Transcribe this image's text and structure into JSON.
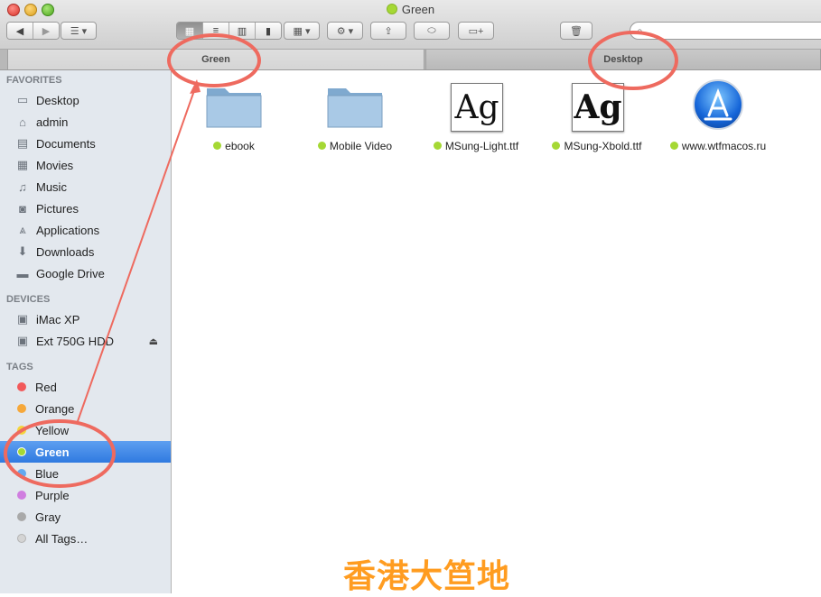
{
  "window": {
    "title": "Green"
  },
  "tabs": [
    {
      "label": "Green",
      "active": true
    },
    {
      "label": "Desktop",
      "active": false
    }
  ],
  "sidebar": {
    "favorites_header": "FAVORITES",
    "favorites": [
      {
        "label": "Desktop",
        "icon": "desktop-icon"
      },
      {
        "label": "admin",
        "icon": "home-icon"
      },
      {
        "label": "Documents",
        "icon": "documents-icon"
      },
      {
        "label": "Movies",
        "icon": "movies-icon"
      },
      {
        "label": "Music",
        "icon": "music-icon"
      },
      {
        "label": "Pictures",
        "icon": "pictures-icon"
      },
      {
        "label": "Applications",
        "icon": "applications-icon"
      },
      {
        "label": "Downloads",
        "icon": "downloads-icon"
      },
      {
        "label": "Google Drive",
        "icon": "folder-icon"
      }
    ],
    "devices_header": "DEVICES",
    "devices": [
      {
        "label": "iMac XP",
        "icon": "hard-drive-icon"
      },
      {
        "label": "Ext 750G HDD",
        "icon": "hard-drive-icon",
        "ejectable": true
      }
    ],
    "tags_header": "TAGS",
    "tags": [
      {
        "label": "Red",
        "color": "#f2595a"
      },
      {
        "label": "Orange",
        "color": "#f6a83a"
      },
      {
        "label": "Yellow",
        "color": "#f4d53b"
      },
      {
        "label": "Green",
        "color": "#a5d834",
        "selected": true
      },
      {
        "label": "Blue",
        "color": "#62a9f1"
      },
      {
        "label": "Purple",
        "color": "#d07ee0"
      },
      {
        "label": "Gray",
        "color": "#a9a9a9"
      },
      {
        "label": "All Tags…",
        "color": "#d4d4d4"
      }
    ]
  },
  "files": [
    {
      "name": "ebook",
      "type": "folder"
    },
    {
      "name": "Mobile Video",
      "type": "folder"
    },
    {
      "name": "MSung-Light.ttf",
      "type": "font"
    },
    {
      "name": "MSung-Xbold.ttf",
      "type": "font-bold"
    },
    {
      "name": "www.wtfmacos.ru",
      "type": "app"
    }
  ],
  "font_preview_text": "Ag",
  "tag_color": "#a5d834",
  "watermark": "香港大笪地"
}
